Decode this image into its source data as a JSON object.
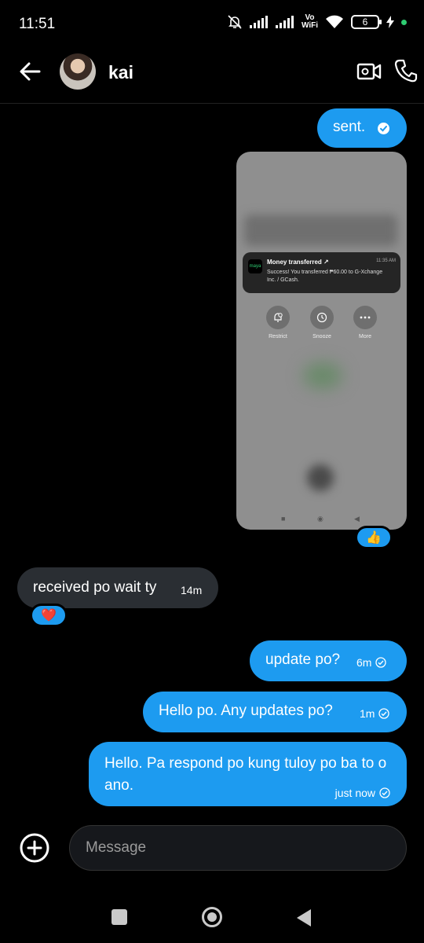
{
  "status_bar": {
    "time": "11:51",
    "network_label_top": "Vo",
    "network_label_bottom": "WiFi",
    "battery": "6"
  },
  "header": {
    "contact_name": "kai"
  },
  "messages": [
    {
      "type": "sent",
      "text": "sent.",
      "status": "read"
    },
    {
      "type": "sent_image",
      "reaction": "👍"
    },
    {
      "type": "received",
      "text": "received po wait ty",
      "time": "14m",
      "reaction": "❤️"
    },
    {
      "type": "sent",
      "text": "update po?",
      "time": "6m"
    },
    {
      "type": "sent",
      "text": "Hello po. Any updates po?",
      "time": "1m"
    },
    {
      "type": "sent",
      "text": "Hello. Pa respond po kung tuloy po ba to o ano.",
      "time": "just now"
    }
  ],
  "image_content": {
    "app_logo": "maya",
    "notif_title": "Money transferred ↗",
    "notif_time": "11:35 AM",
    "notif_body": "Success! You transferred ₱60.00 to G-Xchange Inc. / GCash.",
    "actions": [
      "Restrict",
      "Snooze",
      "More"
    ]
  },
  "composer": {
    "placeholder": "Message"
  },
  "colors": {
    "sent_bubble": "#1d9bf0",
    "received_bubble": "#2a2e33",
    "background": "#000000"
  }
}
